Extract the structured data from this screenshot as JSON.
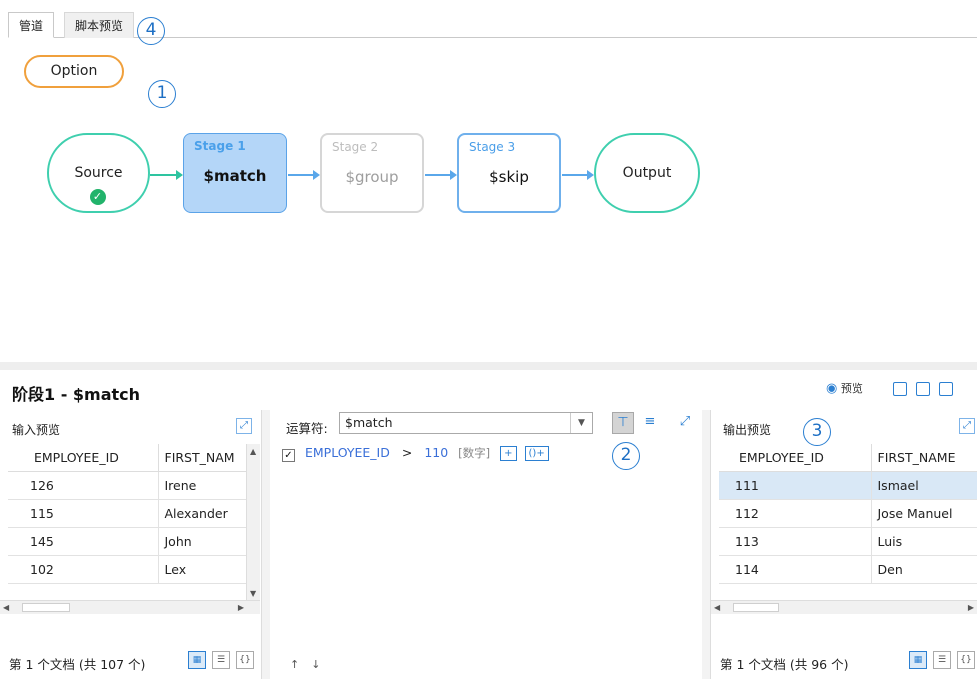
{
  "tabs": [
    "管道",
    "脚本预览"
  ],
  "callouts": [
    "1",
    "2",
    "3",
    "4"
  ],
  "option_label": "Option",
  "pipeline": {
    "source": "Source",
    "output": "Output",
    "stages": [
      {
        "title": "Stage 1",
        "op": "$match",
        "state": "selected"
      },
      {
        "title": "Stage 2",
        "op": "$group",
        "state": "disabled"
      },
      {
        "title": "Stage 3",
        "op": "$skip",
        "state": "normal"
      }
    ]
  },
  "stage_header": "阶段1 - $match",
  "preview_label": "预览",
  "input_preview": {
    "title": "输入预览",
    "columns": [
      "EMPLOYEE_ID",
      "FIRST_NAM"
    ],
    "rows": [
      [
        "126",
        "Irene"
      ],
      [
        "115",
        "Alexander"
      ],
      [
        "145",
        "John"
      ],
      [
        "102",
        "Lex"
      ]
    ],
    "footer": "第 1 个文档 (共 107 个)"
  },
  "operator": {
    "label": "运算符:",
    "value": "$match",
    "condition": {
      "field": "EMPLOYEE_ID",
      "op": ">",
      "value": "110",
      "type": "[数字]",
      "add": "+",
      "add_group": "()+"
    }
  },
  "output_preview": {
    "title": "输出预览",
    "columns": [
      "EMPLOYEE_ID",
      "FIRST_NAME"
    ],
    "rows": [
      [
        "111",
        "Ismael"
      ],
      [
        "112",
        "Jose Manuel"
      ],
      [
        "113",
        "Luis"
      ],
      [
        "114",
        "Den"
      ]
    ],
    "footer": "第 1 个文档 (共 96 个)"
  },
  "colors": {
    "accent": "#2b7fd1",
    "option_border": "#f0a03c",
    "terminal_border": "#3fcfae",
    "stage1_fill": "#b4d6f8",
    "success": "#22b36b"
  }
}
